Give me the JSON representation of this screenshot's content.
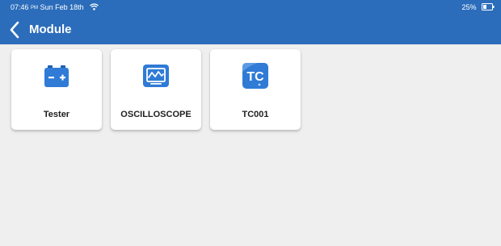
{
  "status_bar": {
    "time": "07:46",
    "ampm": "PM",
    "date": "Sun Feb 18th",
    "battery": "25%"
  },
  "header": {
    "title": "Module"
  },
  "modules": [
    {
      "label": "Tester",
      "icon": "battery-icon"
    },
    {
      "label": "OSCILLOSCOPE",
      "icon": "oscilloscope-icon"
    },
    {
      "label": "TC001",
      "icon": "tc001-icon",
      "icon_text": "TC"
    }
  ],
  "colors": {
    "header_bg": "#2c6dbb",
    "background": "#efefef",
    "icon_blue": "#2f7bd6"
  }
}
